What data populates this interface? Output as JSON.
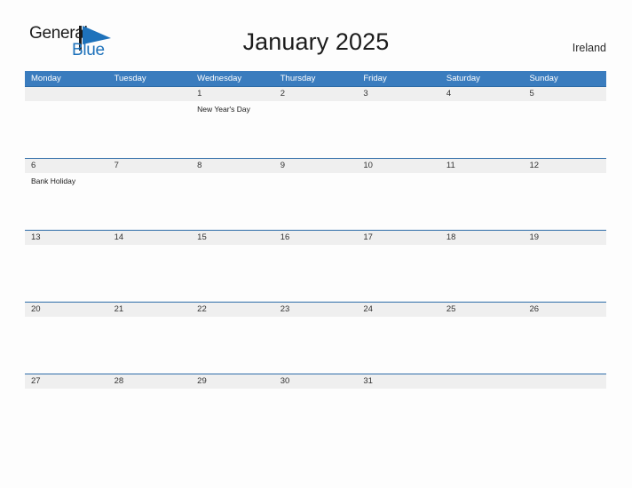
{
  "brand": {
    "name_part1": "General",
    "name_part2": "Blue",
    "mark_icon": "blue-flag-triangle-icon",
    "colors": {
      "blue": "#1e72bb",
      "dark": "#1b1b1b"
    }
  },
  "header": {
    "title": "January 2025",
    "country": "Ireland"
  },
  "calendar": {
    "colors": {
      "header_bar": "#3a7cbe",
      "row_rule": "#2d6ca8",
      "date_band": "#efefef",
      "page_background": "#fdfdfd"
    },
    "weekday_headers": [
      "Monday",
      "Tuesday",
      "Wednesday",
      "Thursday",
      "Friday",
      "Saturday",
      "Sunday"
    ],
    "weeks": [
      [
        {
          "date": "",
          "event": ""
        },
        {
          "date": "",
          "event": ""
        },
        {
          "date": "1",
          "event": "New Year's Day"
        },
        {
          "date": "2",
          "event": ""
        },
        {
          "date": "3",
          "event": ""
        },
        {
          "date": "4",
          "event": ""
        },
        {
          "date": "5",
          "event": ""
        }
      ],
      [
        {
          "date": "6",
          "event": "Bank Holiday"
        },
        {
          "date": "7",
          "event": ""
        },
        {
          "date": "8",
          "event": ""
        },
        {
          "date": "9",
          "event": ""
        },
        {
          "date": "10",
          "event": ""
        },
        {
          "date": "11",
          "event": ""
        },
        {
          "date": "12",
          "event": ""
        }
      ],
      [
        {
          "date": "13",
          "event": ""
        },
        {
          "date": "14",
          "event": ""
        },
        {
          "date": "15",
          "event": ""
        },
        {
          "date": "16",
          "event": ""
        },
        {
          "date": "17",
          "event": ""
        },
        {
          "date": "18",
          "event": ""
        },
        {
          "date": "19",
          "event": ""
        }
      ],
      [
        {
          "date": "20",
          "event": ""
        },
        {
          "date": "21",
          "event": ""
        },
        {
          "date": "22",
          "event": ""
        },
        {
          "date": "23",
          "event": ""
        },
        {
          "date": "24",
          "event": ""
        },
        {
          "date": "25",
          "event": ""
        },
        {
          "date": "26",
          "event": ""
        }
      ],
      [
        {
          "date": "27",
          "event": ""
        },
        {
          "date": "28",
          "event": ""
        },
        {
          "date": "29",
          "event": ""
        },
        {
          "date": "30",
          "event": ""
        },
        {
          "date": "31",
          "event": ""
        },
        {
          "date": "",
          "event": ""
        },
        {
          "date": "",
          "event": ""
        }
      ]
    ]
  }
}
